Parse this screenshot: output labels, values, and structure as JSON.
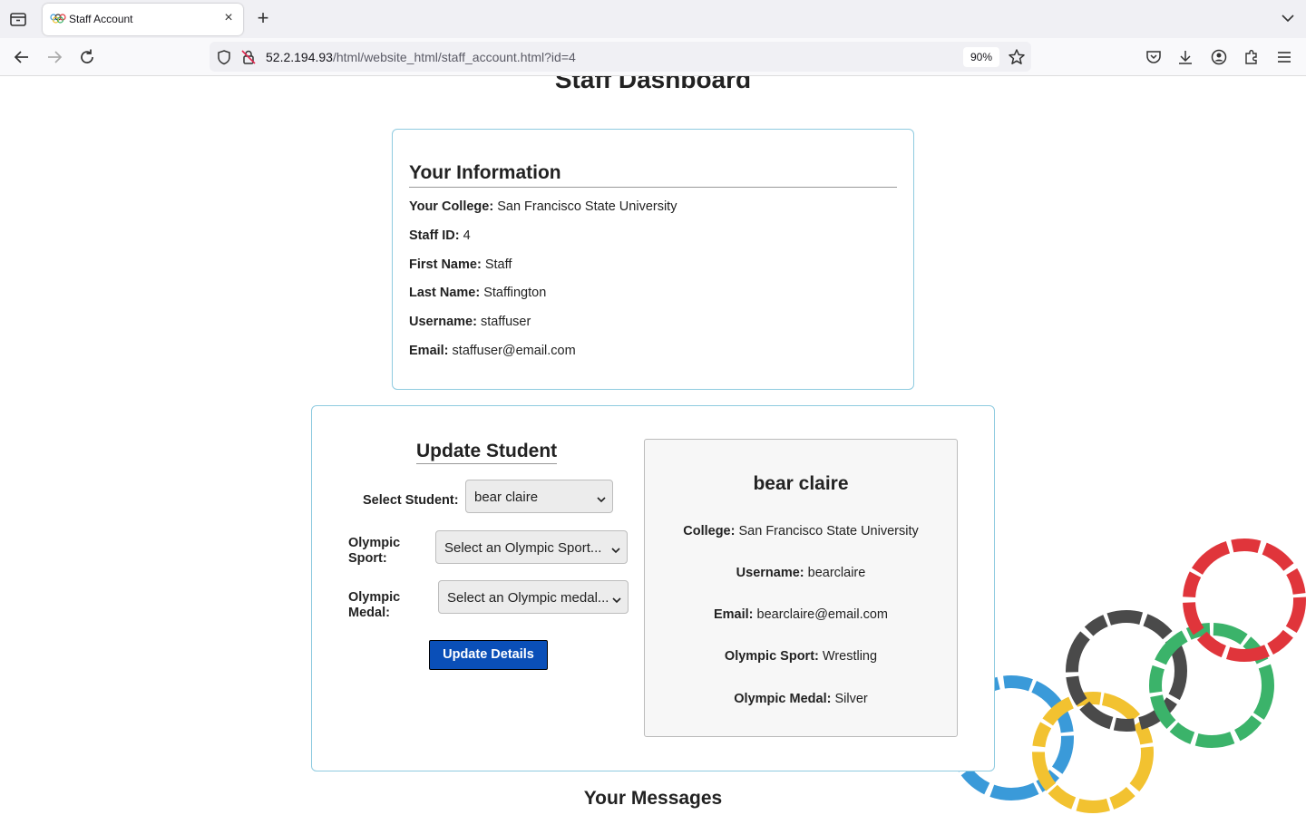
{
  "browser": {
    "tab_title": "Staff Account",
    "url_host": "52.2.194.93",
    "url_path": "/html/website_html/staff_account.html?id=4",
    "zoom": "90%"
  },
  "page": {
    "title": "Staff Dashboard",
    "info": {
      "heading": "Your Information",
      "rows": [
        {
          "label": "Your College:",
          "value": "San Francisco State University"
        },
        {
          "label": "Staff ID:",
          "value": "4"
        },
        {
          "label": "First Name:",
          "value": "Staff"
        },
        {
          "label": "Last Name:",
          "value": "Staffington"
        },
        {
          "label": "Username:",
          "value": "staffuser"
        },
        {
          "label": "Email:",
          "value": "staffuser@email.com"
        }
      ]
    },
    "update": {
      "heading": "Update Student",
      "select_student_label": "Select Student:",
      "select_student_value": "bear claire",
      "sport_label_1": "Olympic",
      "sport_label_2": "Sport:",
      "sport_value": "Select an Olympic Sport...",
      "medal_label_1": "Olympic",
      "medal_label_2": "Medal:",
      "medal_value": "Select an Olympic medal...",
      "button": "Update Details"
    },
    "student": {
      "name": "bear claire",
      "rows": [
        {
          "label": "College:",
          "value": "San Francisco State University"
        },
        {
          "label": "Username:",
          "value": "bearclaire"
        },
        {
          "label": "Email:",
          "value": "bearclaire@email.com"
        },
        {
          "label": "Olympic Sport:",
          "value": "Wrestling"
        },
        {
          "label": "Olympic Medal:",
          "value": "Silver"
        }
      ]
    },
    "messages_heading": "Your Messages"
  },
  "colors": {
    "accent_button": "#0a4fb8",
    "card_border": "#8fcbe0",
    "ring_blue": "#3a9ad9",
    "ring_yellow": "#f2c230",
    "ring_black": "#4a4a4a",
    "ring_green": "#3bb36a",
    "ring_red": "#e0353b"
  },
  "icons": [
    "tab-list-icon",
    "olympic-favicon",
    "close-icon",
    "plus-icon",
    "chevron-down-icon",
    "back-icon",
    "forward-icon",
    "reload-icon",
    "shield-icon",
    "insecure-lock-icon",
    "star-icon",
    "pocket-icon",
    "download-icon",
    "account-icon",
    "extensions-icon",
    "menu-icon"
  ]
}
